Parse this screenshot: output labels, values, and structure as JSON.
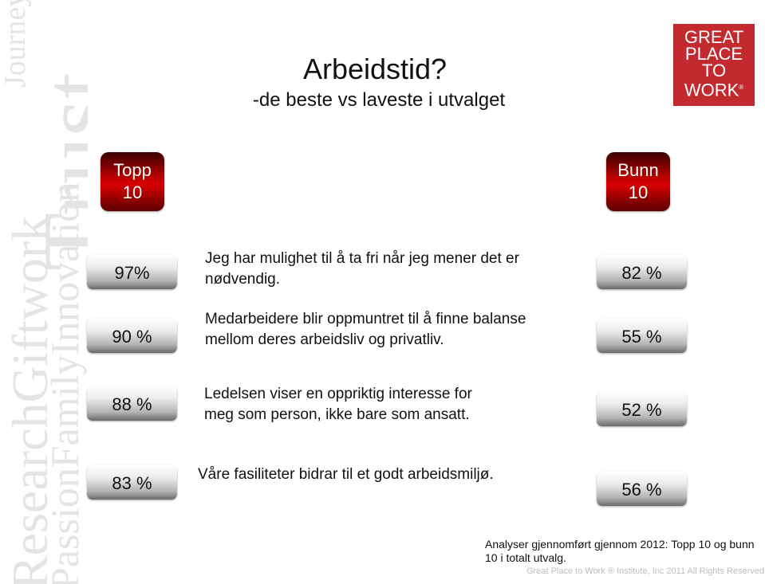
{
  "background_words": [
    "ResearchGiftwork",
    "PassionFamilyInnovation",
    "Journey",
    "Trust"
  ],
  "title": "Arbeidstid?",
  "subtitle": "-de beste vs laveste i utvalget",
  "logo": {
    "lines": [
      "GREAT",
      "PLACE",
      "TO",
      "WORK"
    ],
    "mark": "®",
    "color": "#c32a30"
  },
  "groups": {
    "top": {
      "line1": "Topp",
      "line2": "10"
    },
    "bottom": {
      "line1": "Bunn",
      "line2": "10"
    }
  },
  "rows": [
    {
      "statement": "Jeg har mulighet til å ta fri når jeg mener det er nødvendig.",
      "top": "97%",
      "bottom": "82 %"
    },
    {
      "statement": "Medarbeidere blir oppmuntret til å finne balanse mellom deres arbeidsliv og privatliv.",
      "top": "90 %",
      "bottom": "55 %"
    },
    {
      "statement": "Ledelsen viser en oppriktig interesse for meg som person, ikke bare som ansatt.",
      "top": "88 %",
      "bottom": "52 %"
    },
    {
      "statement": "Våre fasiliteter bidrar til et godt arbeidsmiljø.",
      "top": "83 %",
      "bottom": "56 %"
    }
  ],
  "footnote": "Analyser gjennomført gjennom 2012: Topp 10 og bunn 10 i totalt utvalg.",
  "copyright": "Great Place to Work ® Institute, Inc 2011 All Rights Reserved"
}
